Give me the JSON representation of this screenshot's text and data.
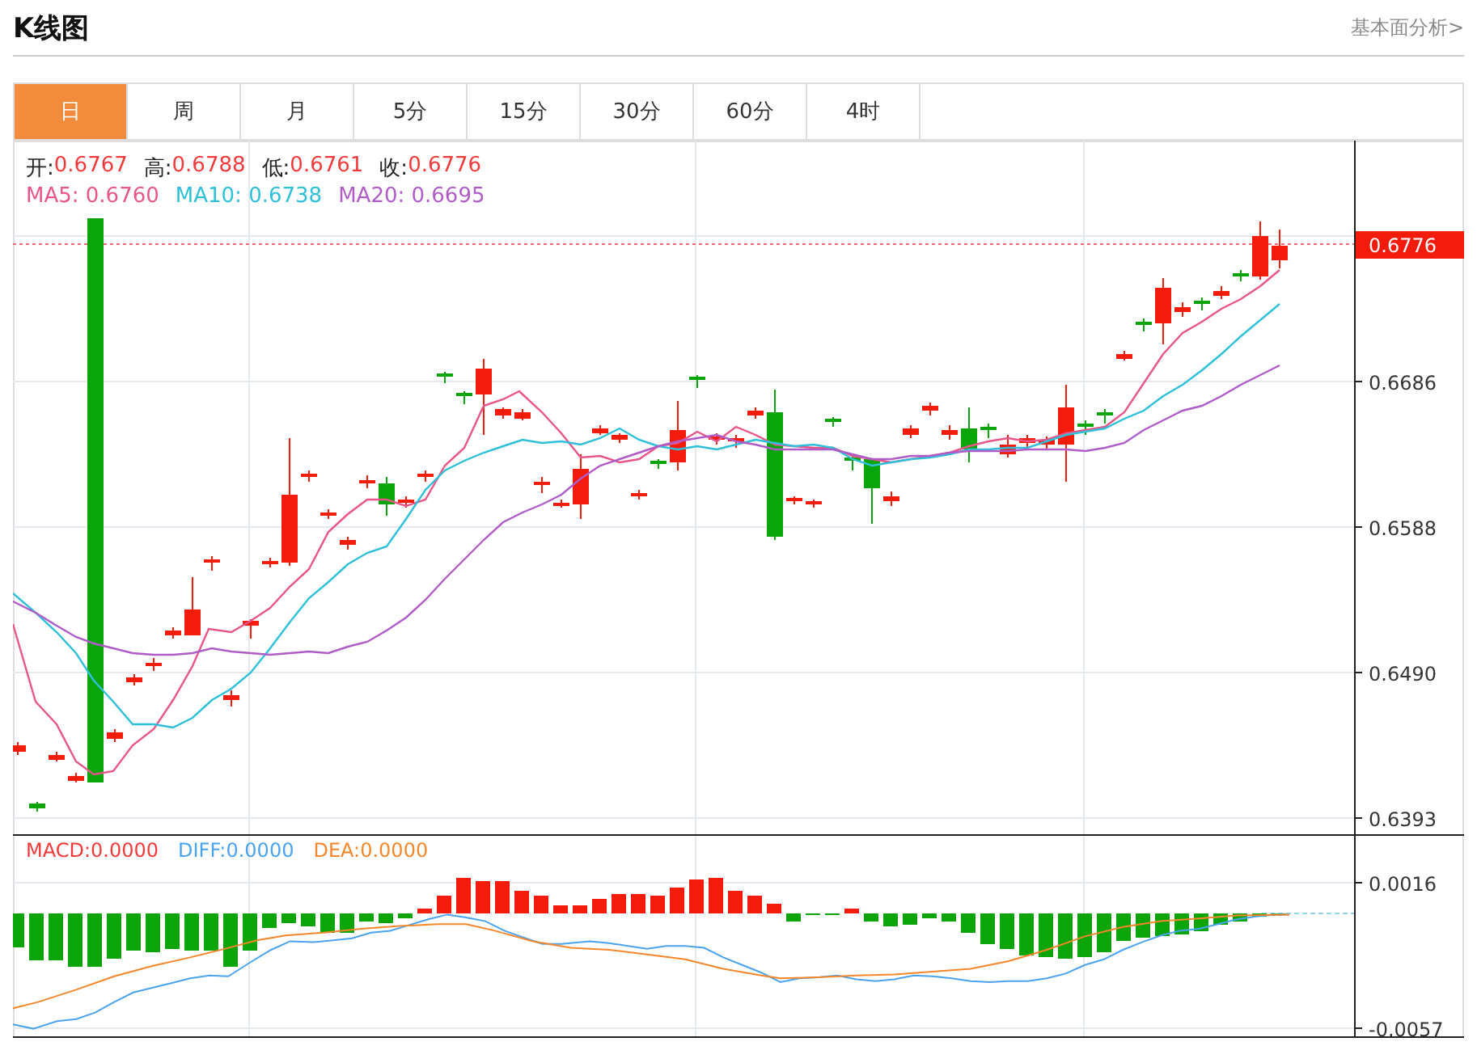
{
  "header": {
    "title": "K线图",
    "link": "基本面分析>"
  },
  "tabs": [
    {
      "label": "日",
      "selected": true
    },
    {
      "label": "周",
      "selected": false
    },
    {
      "label": "月",
      "selected": false
    },
    {
      "label": "5分",
      "selected": false
    },
    {
      "label": "15分",
      "selected": false
    },
    {
      "label": "30分",
      "selected": false
    },
    {
      "label": "60分",
      "selected": false
    },
    {
      "label": "4时",
      "selected": false
    }
  ],
  "quote": [
    {
      "label": "开:",
      "value": "0.6767"
    },
    {
      "label": "高:",
      "value": "0.6788"
    },
    {
      "label": "低:",
      "value": "0.6761"
    },
    {
      "label": "收:",
      "value": "0.6776"
    }
  ],
  "moving_averages": [
    {
      "label": "MA5:",
      "value": "0.6760",
      "color": "#e8558a"
    },
    {
      "label": "MA10:",
      "value": "0.6738",
      "color": "#2fc0d9"
    },
    {
      "label": "MA20:",
      "value": "0.6695",
      "color": "#b05cc8"
    }
  ],
  "price_axis": {
    "ticks": [
      "0.6686",
      "0.6588",
      "0.6490",
      "0.6393"
    ],
    "last_price": "0.6776"
  },
  "macd_legend": [
    {
      "label": "MACD:",
      "value": "0.0000",
      "color": "#f23a3a"
    },
    {
      "label": "DIFF:",
      "value": "0.0000",
      "color": "#4aa3ef"
    },
    {
      "label": "DEA:",
      "value": "0.0000",
      "color": "#f5862a"
    }
  ],
  "macd_axis": {
    "ticks": [
      "0.0016",
      "-0.0057"
    ]
  }
}
